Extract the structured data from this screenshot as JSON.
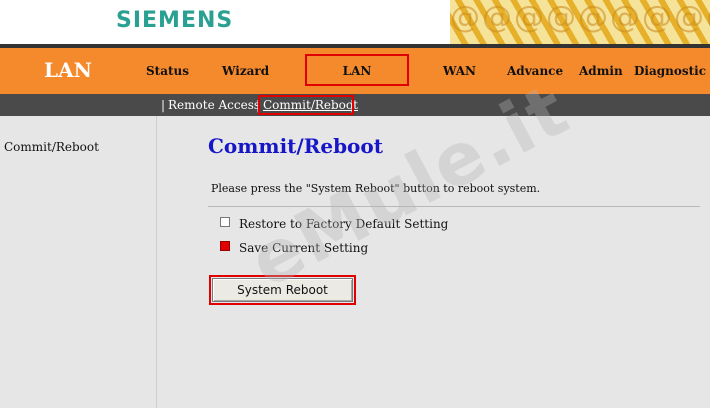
{
  "header": {
    "logo": "SIEMENS",
    "decoration_text": "@@@@@@@@@"
  },
  "nav": {
    "section_title": "LAN",
    "items": [
      "Status",
      "Wizard",
      "LAN",
      "WAN",
      "Advance",
      "Admin",
      "Diagnostic"
    ]
  },
  "subnav": {
    "items": [
      "Remote Access",
      "Commit/Reboot"
    ],
    "pipe": "|"
  },
  "sidebar": {
    "items": [
      "Commit/Reboot"
    ]
  },
  "main": {
    "title": "Commit/Reboot",
    "description": "Please press the \"System Reboot\" button to reboot system.",
    "options": [
      {
        "label": "Restore to Factory Default Setting",
        "checked": false
      },
      {
        "label": "Save Current Setting",
        "checked": true
      }
    ],
    "button_label": "System Reboot"
  },
  "watermark": "eMule.it",
  "colors": {
    "nav_bg": "#f58a2d",
    "subnav_bg": "#4a4a4a",
    "title": "#1616c8",
    "highlight": "#e10000",
    "logo": "#2aa092"
  }
}
